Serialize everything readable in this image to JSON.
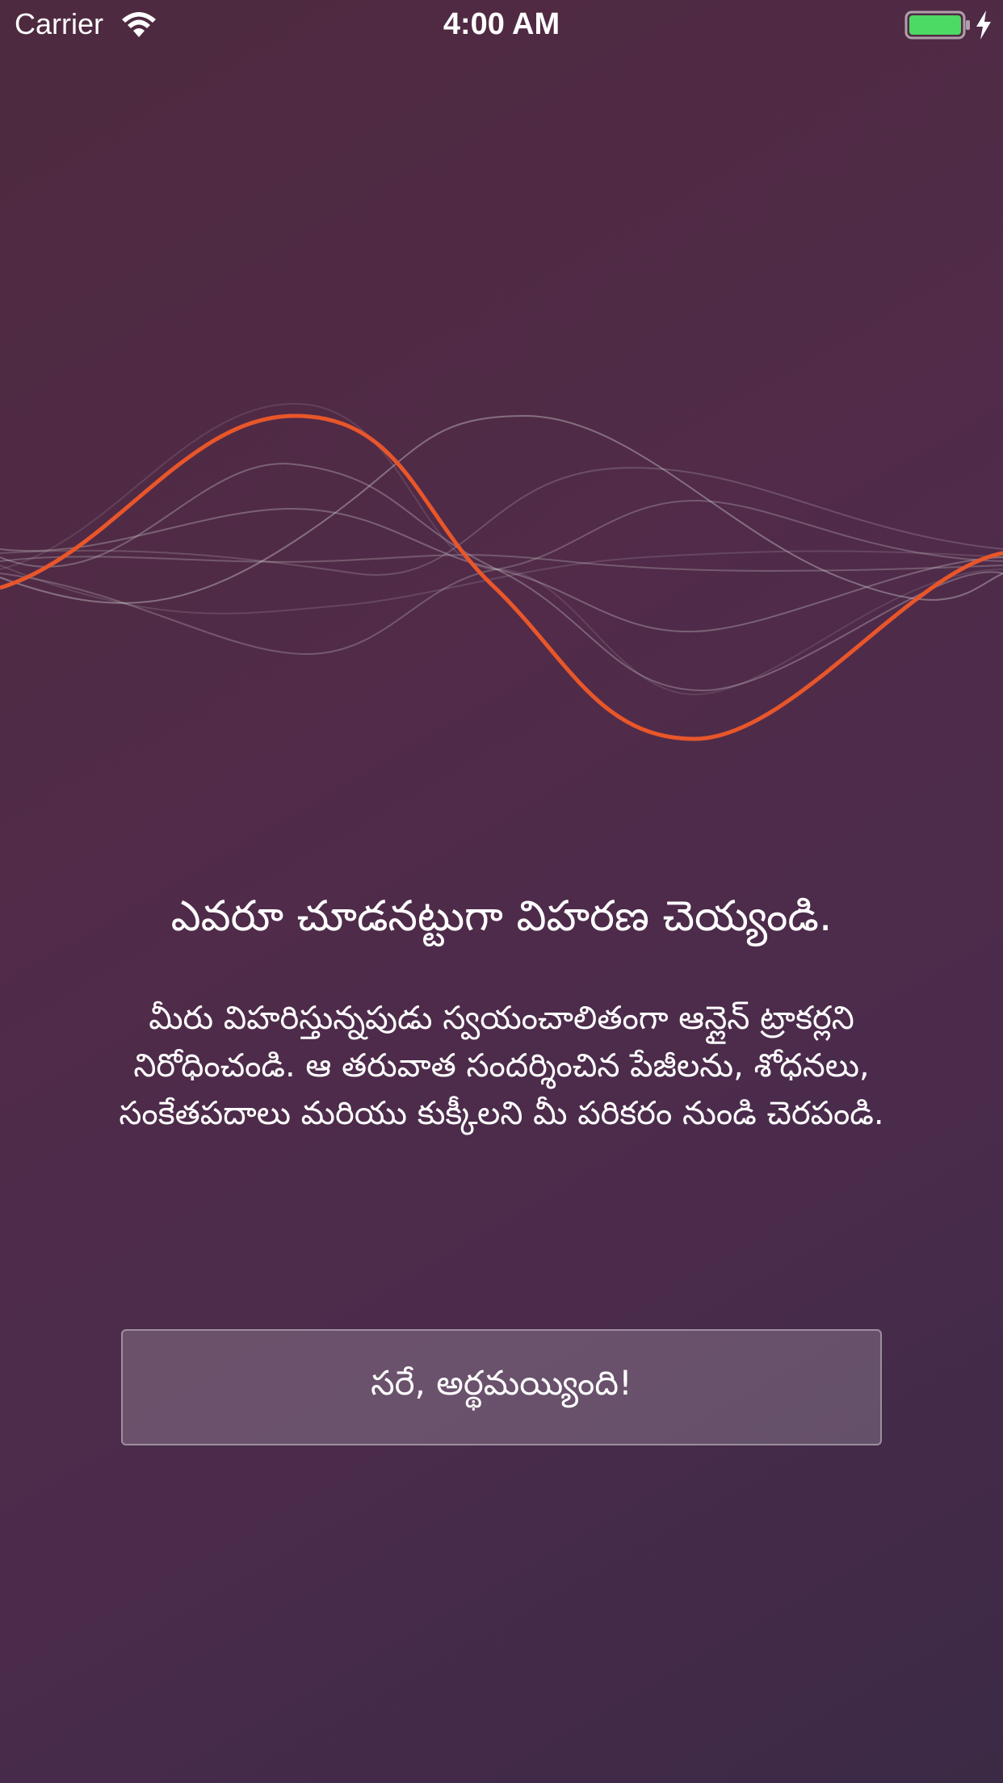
{
  "status_bar": {
    "carrier": "Carrier",
    "time": "4:00 AM",
    "icons": [
      "wifi-icon",
      "battery-icon",
      "charging-bolt-icon"
    ],
    "battery_level": 1.0,
    "battery_color": "#4cd964"
  },
  "graphic": {
    "icon": "sound-wave-illustration",
    "accent_color": "#e8562a"
  },
  "onboarding": {
    "title": "ఎవరూ చూడనట్టుగా విహరణ చెయ్యండి.",
    "description": "మీరు విహరిస్తున్నపుడు స్వయంచాలితంగా ఆన్లైన్ ట్రాకర్లని నిరోధించండి. ఆ తరువాత సందర్శించిన పేజీలను, శోధనలు, సంకేతపదాలు మరియు కుక్కీలని మీ పరికరం నుండి చెరపండి.",
    "button_label": "సరే, అర్థమయ్యింది!"
  }
}
